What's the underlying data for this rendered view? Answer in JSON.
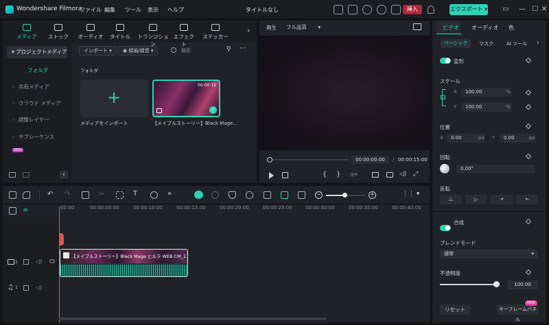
{
  "app": {
    "name": "Wondershare Filmora",
    "doc_title": "タイトルなし",
    "insert_label": "挿入",
    "export_label": "エクスポート"
  },
  "menu": [
    "ファイル",
    "編集",
    "ツール",
    "表示",
    "ヘルプ"
  ],
  "media_tabs": [
    {
      "label": "メディア",
      "icon": "media-icon"
    },
    {
      "label": "ストック",
      "icon": "stock-icon"
    },
    {
      "label": "オーディオ",
      "icon": "music-icon"
    },
    {
      "label": "タイトル",
      "icon": "title-icon"
    },
    {
      "label": "トランジション",
      "icon": "transition-icon"
    },
    {
      "label": "エフェクト",
      "icon": "effect-icon"
    },
    {
      "label": "ステッカー",
      "icon": "sticker-icon"
    }
  ],
  "sidebar": {
    "project_media": "プロジェクトメディア",
    "folder": "フォルダ",
    "items": [
      "共有メディア",
      "クラウド メディア",
      "調整レイヤー",
      "サブシーケンス"
    ],
    "new_badge": "NEW"
  },
  "media_toolbar": {
    "import": "インポート",
    "record": "録画/録音",
    "search_placeholder": "検索"
  },
  "media": {
    "folder_label": "フォルダ",
    "import_tile": "メディアをインポート",
    "clip_name": "【メイプルストーリー】Black Mage...",
    "clip_duration": "00:00:15"
  },
  "player": {
    "play_label": "再生",
    "quality": "フル品質",
    "current_time": "00:00:00:00",
    "total_time": "00:00:15:00",
    "separator": "/"
  },
  "props": {
    "tabs": [
      "ビデオ",
      "オーディオ",
      "色"
    ],
    "subtabs": [
      "ベーシック",
      "マスク",
      "AI ツール"
    ],
    "transform": "変形",
    "scale": "スケール",
    "scale_x": "100.00",
    "scale_y": "100.00",
    "pct": "%",
    "position": "位置",
    "pos_x": "0.00",
    "pos_y": "0.00",
    "px": "px",
    "rotation": "回転",
    "rotation_val": "0.00°",
    "flip": "反転",
    "composite": "合成",
    "blend_mode": "ブレンドモード",
    "blend_val": "通常",
    "opacity": "不透明度",
    "opacity_val": "100.00",
    "opacity_level": 1.0,
    "reset": "リセット",
    "keyframe": "キーフレームパネル",
    "new_badge": "NEW",
    "x": "X",
    "y": "Y"
  },
  "timeline": {
    "ticks": [
      "00:00",
      "00:00:05:00",
      "00:00:10:00",
      "00:00:15:00",
      "00:00:20:00",
      "00:00:25:00",
      "00:00:30:00",
      "00:00:35:00",
      "00:00:40:00"
    ],
    "clip_label": "【メイプルストーリー】Black Mage ヒルラ WEB CM_1",
    "video_track": "1",
    "audio_track": "1"
  },
  "colors": {
    "accent": "#2ed3b7",
    "insert": "#b3263d",
    "playhead": "#e2534b"
  }
}
